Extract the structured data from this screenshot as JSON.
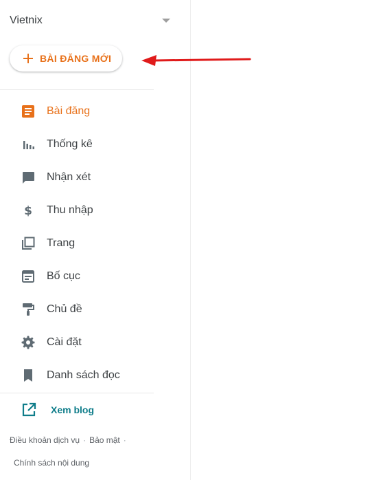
{
  "sidebar": {
    "blog_name": "Vietnix",
    "new_post_label": "BÀI ĐĂNG MỚI",
    "items": [
      {
        "label": "Bài đăng",
        "icon": "posts-icon",
        "active": true
      },
      {
        "label": "Thống kê",
        "icon": "stats-icon"
      },
      {
        "label": "Nhận xét",
        "icon": "comments-icon"
      },
      {
        "label": "Thu nhập",
        "icon": "dollar-icon"
      },
      {
        "label": "Trang",
        "icon": "pages-icon"
      },
      {
        "label": "Bố cục",
        "icon": "layout-icon"
      },
      {
        "label": "Chủ đề",
        "icon": "paint-roller-icon"
      },
      {
        "label": "Cài đặt",
        "icon": "gear-icon"
      },
      {
        "label": "Danh sách đọc",
        "icon": "bookmark-icon"
      }
    ],
    "view_blog_label": "Xem blog",
    "footer": {
      "terms": "Điều khoản dịch vụ",
      "privacy": "Bảo mật",
      "content_policy": "Chính sách nội dung",
      "separator": "·"
    }
  },
  "colors": {
    "accent": "#e8711a",
    "icon": "#5f6b73",
    "link": "#0f7d8a",
    "annotation_arrow": "#e01b1b"
  }
}
